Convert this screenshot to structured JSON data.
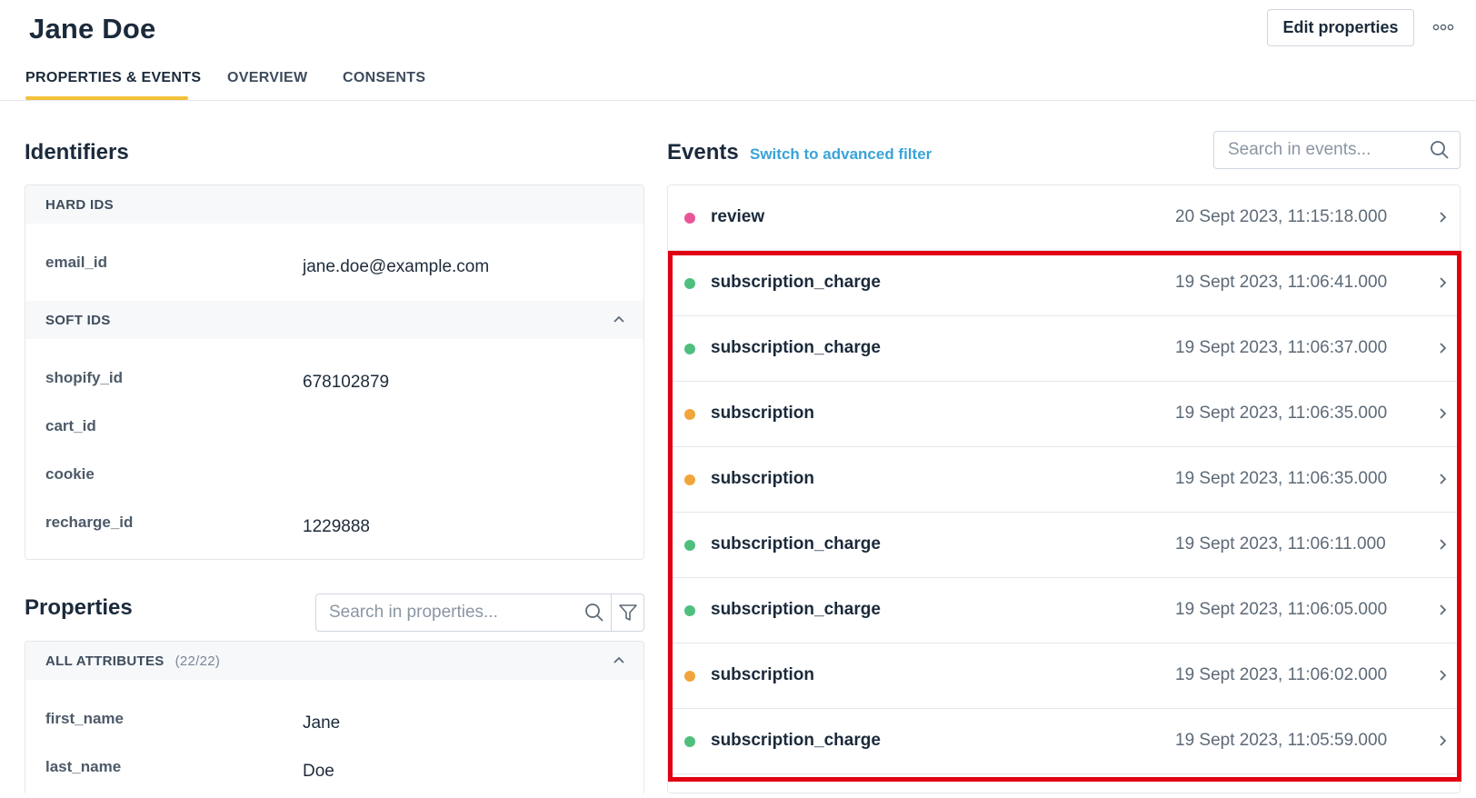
{
  "profile": {
    "name": "Jane Doe",
    "edit_label": "Edit properties",
    "more_icon": "more-horizontal-icon"
  },
  "tabs": [
    {
      "label": "PROPERTIES & EVENTS",
      "active": true
    },
    {
      "label": "OVERVIEW",
      "active": false
    },
    {
      "label": "CONSENTS",
      "active": false
    }
  ],
  "identifiers": {
    "title": "Identifiers",
    "hard_ids": {
      "header": "HARD IDS",
      "items": [
        {
          "key": "email_id",
          "value": "jane.doe@example.com"
        }
      ]
    },
    "soft_ids": {
      "header": "SOFT IDS",
      "items": [
        {
          "key": "shopify_id",
          "value": "678102879"
        },
        {
          "key": "cart_id",
          "value": ""
        },
        {
          "key": "cookie",
          "value": ""
        },
        {
          "key": "recharge_id",
          "value": "1229888"
        }
      ]
    }
  },
  "properties": {
    "title": "Properties",
    "search_placeholder": "Search in properties...",
    "all_attributes": {
      "header": "ALL ATTRIBUTES",
      "count": "(22/22)",
      "items": [
        {
          "key": "first_name",
          "value": "Jane"
        },
        {
          "key": "last_name",
          "value": "Doe"
        }
      ]
    }
  },
  "events": {
    "title": "Events",
    "advanced_filter_label": "Switch to advanced filter",
    "search_placeholder": "Search in events...",
    "colors": {
      "review": "#e8559a",
      "subscription_charge": "#4fbf7e",
      "subscription": "#f2a53a",
      "highlight": "#e00012",
      "link": "#3aa3d8",
      "tab_underline": "#f3c13a"
    },
    "items": [
      {
        "name": "review",
        "time": "20 Sept 2023, 11:15:18.000",
        "color": "#e8559a"
      },
      {
        "name": "subscription_charge",
        "time": "19 Sept 2023, 11:06:41.000",
        "color": "#4fbf7e"
      },
      {
        "name": "subscription_charge",
        "time": "19 Sept 2023, 11:06:37.000",
        "color": "#4fbf7e"
      },
      {
        "name": "subscription",
        "time": "19 Sept 2023, 11:06:35.000",
        "color": "#f2a53a"
      },
      {
        "name": "subscription",
        "time": "19 Sept 2023, 11:06:35.000",
        "color": "#f2a53a"
      },
      {
        "name": "subscription_charge",
        "time": "19 Sept 2023, 11:06:11.000",
        "color": "#4fbf7e"
      },
      {
        "name": "subscription_charge",
        "time": "19 Sept 2023, 11:06:05.000",
        "color": "#4fbf7e"
      },
      {
        "name": "subscription",
        "time": "19 Sept 2023, 11:06:02.000",
        "color": "#f2a53a"
      },
      {
        "name": "subscription_charge",
        "time": "19 Sept 2023, 11:05:59.000",
        "color": "#4fbf7e"
      }
    ]
  }
}
